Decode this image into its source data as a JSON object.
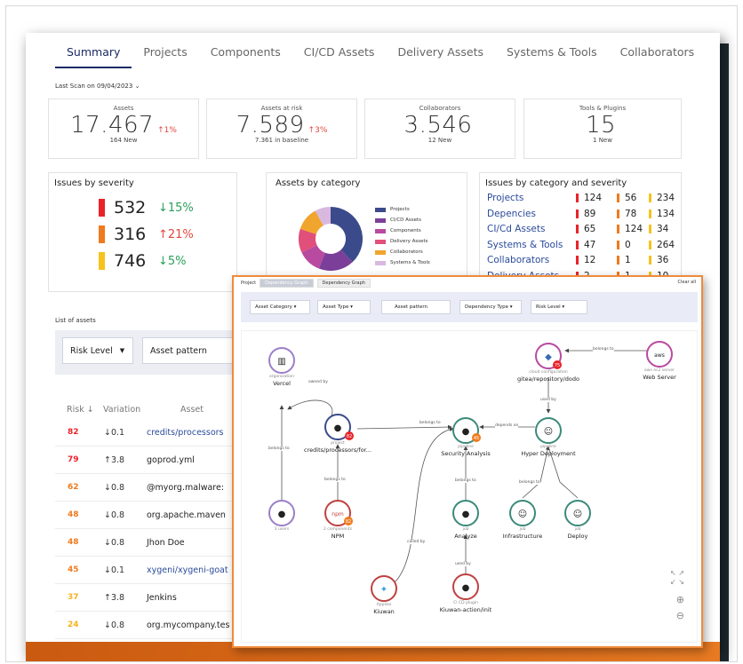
{
  "tabs": [
    "Summary",
    "Projects",
    "Components",
    "CI/CD Assets",
    "Delivery Assets",
    "Systems & Tools",
    "Collaborators"
  ],
  "last_scan": "Last Scan on 09/04/2023 ⌄",
  "stats": [
    {
      "title": "Assets",
      "value": "17.467",
      "delta": "↑1%",
      "sub": "164 New"
    },
    {
      "title": "Assets at risk",
      "value": "7.589",
      "delta": "↑3%",
      "sub": "7.361 in baseline"
    },
    {
      "title": "Collaborators",
      "value": "3.546",
      "delta": "",
      "sub": "12 New"
    },
    {
      "title": "Tools & Plugins",
      "value": "15",
      "delta": "",
      "sub": "1 New"
    }
  ],
  "severity": {
    "title": "Issues by severity",
    "rows": [
      {
        "value": "532",
        "delta": "↓15%",
        "bar_color": "#e8232a",
        "delta_color": "#2aa05a"
      },
      {
        "value": "316",
        "delta": "↑21%",
        "bar_color": "#f07a1e",
        "delta_color": "#e2453c"
      },
      {
        "value": "746",
        "delta": "↓5%",
        "bar_color": "#f6c21c",
        "delta_color": "#2aa05a"
      }
    ]
  },
  "category": {
    "title": "Assets by category",
    "legend": [
      {
        "label": "Projects",
        "color": "#3b4a8a"
      },
      {
        "label": "CI/CD Assets",
        "color": "#7b3f9a"
      },
      {
        "label": "Components",
        "color": "#b84aa0"
      },
      {
        "label": "Delivery Assets",
        "color": "#e0507a"
      },
      {
        "label": "Collaborators",
        "color": "#f0a52e"
      },
      {
        "label": "Systems & Tools",
        "color": "#d9b8e0"
      }
    ],
    "donut": [
      {
        "value": 38,
        "color": "#3b4a8a"
      },
      {
        "value": 18,
        "color": "#7b3f9a"
      },
      {
        "value": 12,
        "color": "#b84aa0"
      },
      {
        "value": 12,
        "color": "#e0507a"
      },
      {
        "value": 12,
        "color": "#f0a52e"
      },
      {
        "value": 8,
        "color": "#d9b8e0"
      }
    ]
  },
  "cat_severity": {
    "title": "Issues by category and severity",
    "rows": [
      {
        "name": "Projects",
        "c": "124",
        "h": "56",
        "m": "234"
      },
      {
        "name": "Depencies",
        "c": "89",
        "h": "78",
        "m": "134"
      },
      {
        "name": "CI/Cd Assets",
        "c": "65",
        "h": "124",
        "m": "34"
      },
      {
        "name": "Systems & Tools",
        "c": "47",
        "h": "0",
        "m": "264"
      },
      {
        "name": "Collaborators",
        "c": "12",
        "h": "1",
        "m": "36"
      },
      {
        "name": "Delivery Assets",
        "c": "2",
        "h": "1",
        "m": "10"
      }
    ]
  },
  "list": {
    "title": "List of assets",
    "filter_risk": "Risk Level",
    "filter_pattern": "Asset pattern",
    "headers": {
      "risk": "Risk",
      "variation": "Variation",
      "asset": "Asset"
    },
    "rows": [
      {
        "risk": "82",
        "color": "#e8232a",
        "variation": "↓0.1",
        "asset": "credits/processors",
        "link": true
      },
      {
        "risk": "79",
        "color": "#e8232a",
        "variation": "↑3.8",
        "asset": "goprod.yml",
        "link": false
      },
      {
        "risk": "62",
        "color": "#f07a1e",
        "variation": "↓0.8",
        "asset": "@myorg.malware:",
        "link": false
      },
      {
        "risk": "48",
        "color": "#f07a1e",
        "variation": "↓0.8",
        "asset": "org.apache.maven",
        "link": false
      },
      {
        "risk": "48",
        "color": "#f07a1e",
        "variation": "↓0.8",
        "asset": "Jhon Doe",
        "link": false
      },
      {
        "risk": "45",
        "color": "#f07a1e",
        "variation": "↓0.1",
        "asset": "xygeni/xygeni-goat",
        "link": true
      },
      {
        "risk": "37",
        "color": "#f6b21c",
        "variation": "↑3.8",
        "asset": "Jenkins",
        "link": false
      },
      {
        "risk": "24",
        "color": "#f6b21c",
        "variation": "↓0.8",
        "asset": "org.mycompany.tes",
        "link": false
      }
    ]
  },
  "overlay": {
    "top_label": "Project",
    "tab_active": "Dependency Graph",
    "tab_other": "Dependency Graph",
    "clear": "Clear all",
    "filters": [
      "Asset Category ▾",
      "Asset Type ▾",
      "Asset pattern",
      "Dependency Type ▾",
      "Risk Level ▾"
    ],
    "nodes": [
      {
        "type": "organization",
        "name": "Vercel"
      },
      {
        "type": "project",
        "name": "credits/processors/for..."
      },
      {
        "type": "pipeline",
        "name": "Security Analysis"
      },
      {
        "type": "pipeline",
        "name": "Hyper Deployment"
      },
      {
        "type": "cloud configuration",
        "name": "gitea/repository/dodo"
      },
      {
        "type": "aws ec2 server",
        "name": "Web Server"
      },
      {
        "type": "3 users",
        "name": ""
      },
      {
        "type": "2 components",
        "name": "NPM"
      },
      {
        "type": "job",
        "name": "Analyze"
      },
      {
        "type": "job",
        "name": "Infrastructure"
      },
      {
        "type": "job",
        "name": "Deploy"
      },
      {
        "type": "Appliex",
        "name": "Kiuwan"
      },
      {
        "type": "CI CD plugin",
        "name": "Kiuwan-action/init"
      }
    ],
    "edges": [
      "owned by",
      "belongs to",
      "belongs to",
      "depends on",
      "belongs to",
      "used by",
      "belongs to",
      "belongs to",
      "belongs to",
      "called by",
      "used by"
    ],
    "badges": [
      "82",
      "45",
      "82",
      "75"
    ],
    "aws": "aws",
    "npm": "npm",
    "zoom": [
      "↖ ↗",
      "↙ ↘",
      "⊕",
      "⊖"
    ]
  }
}
